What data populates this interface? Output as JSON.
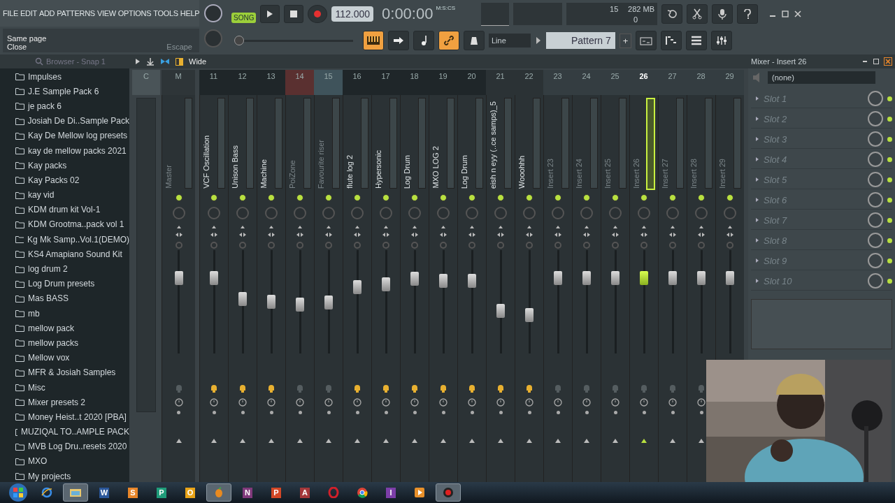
{
  "menu": [
    "FILE",
    "EDIT",
    "ADD",
    "PATTERNS",
    "VIEW",
    "OPTIONS",
    "TOOLS",
    "HELP"
  ],
  "hint": {
    "title": "Same page",
    "action": "Close",
    "shortcut": "Escape"
  },
  "transport": {
    "mode": "SONG",
    "playing": false,
    "recording": true,
    "tempo": "112.000",
    "time": "0:00:00",
    "time_unit": "M:S:CS"
  },
  "performance": {
    "cpu": "15",
    "memory": "282 MB",
    "polyphony": "0"
  },
  "pitch": {
    "level": 0
  },
  "snap": "Line",
  "pattern": "Pattern 7",
  "pattern_add": "+",
  "browser": {
    "title": "Browser - Snap 1",
    "items": [
      "Impulses",
      "J.E Sample Pack 6",
      "je pack 6",
      "Josiah De Di..Sample Pack",
      "Kay De Mellow log presets",
      "kay de mellow packs 2021",
      "Kay packs",
      "Kay Packs 02",
      "kay vid",
      "KDM drum kit Vol-1",
      "KDM Grootma..pack  vol 1",
      "Kg Mk Samp..Vol.1(DEMO)",
      "KS4 Amapiano Sound Kit",
      "log drum 2",
      "Log Drum presets",
      "Mas BASS",
      "mb",
      "mellow pack",
      "mellow packs",
      "Mellow vox",
      "MFR & Josiah Samples",
      "Misc",
      "Mixer presets 2",
      "Money Heist..t 2020 [PBA]",
      "MUZIQAL TO..AMPLE PACK",
      "MVB Log Dru..resets 2020",
      "MXO",
      "My projects"
    ]
  },
  "mixer": {
    "view": "Wide",
    "current_column": "C",
    "tracks": [
      {
        "number": "M",
        "name": "Master",
        "level": 0.73,
        "color": "#2e3538",
        "active": false,
        "selected": false
      },
      {
        "number": "11",
        "name": "VCF Oscillation",
        "level": 0.73,
        "color": "#1f2629",
        "active": true,
        "selected": false
      },
      {
        "number": "12",
        "name": "Unison Bass",
        "level": 0.53,
        "color": "#1f2629",
        "active": true,
        "selected": false
      },
      {
        "number": "13",
        "name": "Machine",
        "level": 0.5,
        "color": "#1f2629",
        "active": true,
        "selected": false
      },
      {
        "number": "14",
        "name": "PoiZone",
        "level": 0.47,
        "color": "#5a3030",
        "active": false,
        "selected": false
      },
      {
        "number": "15",
        "name": "Favourite riser",
        "level": 0.49,
        "color": "#3f535b",
        "active": false,
        "selected": false
      },
      {
        "number": "16",
        "name": "flute log 2",
        "level": 0.64,
        "color": "#1f2629",
        "active": true,
        "selected": false
      },
      {
        "number": "17",
        "name": "Hypersonic",
        "level": 0.67,
        "color": "#1f2629",
        "active": true,
        "selected": false
      },
      {
        "number": "18",
        "name": "Log Drum",
        "level": 0.72,
        "color": "#1f2629",
        "active": true,
        "selected": false
      },
      {
        "number": "19",
        "name": "MXO LOG 2",
        "level": 0.7,
        "color": "#1f2629",
        "active": true,
        "selected": false
      },
      {
        "number": "20",
        "name": "Log Drum",
        "level": 0.7,
        "color": "#1f2629",
        "active": true,
        "selected": false
      },
      {
        "number": "21",
        "name": "eish n eyy (..ce samps)_5",
        "level": 0.41,
        "color": "#2b3235",
        "active": true,
        "selected": false
      },
      {
        "number": "22",
        "name": "Wooohhh",
        "level": 0.37,
        "color": "#2b3235",
        "active": true,
        "selected": false
      },
      {
        "number": "23",
        "name": "Insert 23",
        "level": 0.73,
        "color": "#343d41",
        "active": false,
        "selected": false
      },
      {
        "number": "24",
        "name": "Insert 24",
        "level": 0.73,
        "color": "#343d41",
        "active": false,
        "selected": false
      },
      {
        "number": "25",
        "name": "Insert 25",
        "level": 0.73,
        "color": "#343d41",
        "active": false,
        "selected": false
      },
      {
        "number": "26",
        "name": "Insert 26",
        "level": 0.73,
        "color": "#343d41",
        "active": false,
        "selected": true
      },
      {
        "number": "27",
        "name": "Insert 27",
        "level": 0.73,
        "color": "#343d41",
        "active": false,
        "selected": false
      },
      {
        "number": "28",
        "name": "Insert 28",
        "level": 0.73,
        "color": "#343d41",
        "active": false,
        "selected": false
      },
      {
        "number": "29",
        "name": "Insert 29",
        "level": 0.73,
        "color": "#343d41",
        "active": false,
        "selected": false
      }
    ]
  },
  "insert_panel": {
    "title": "Mixer - Insert 26",
    "preset": "(none)",
    "slots": [
      "Slot 1",
      "Slot 2",
      "Slot 3",
      "Slot 4",
      "Slot 5",
      "Slot 6",
      "Slot 7",
      "Slot 8",
      "Slot 9",
      "Slot 10"
    ]
  },
  "taskbar": [
    {
      "kind": "browser",
      "selected": false
    },
    {
      "kind": "folder",
      "selected": true
    },
    {
      "kind": "letter",
      "label": "W",
      "color": "#2b579a",
      "selected": false
    },
    {
      "kind": "letter",
      "label": "S",
      "color": "#e8862a",
      "selected": false
    },
    {
      "kind": "letter",
      "label": "P",
      "color": "#1f9c7a",
      "selected": false
    },
    {
      "kind": "letter",
      "label": "O",
      "color": "#e8a317",
      "selected": false
    },
    {
      "kind": "fl",
      "selected": true
    },
    {
      "kind": "letter",
      "label": "N",
      "color": "#80397b",
      "selected": false
    },
    {
      "kind": "letter",
      "label": "P",
      "color": "#d24726",
      "selected": false
    },
    {
      "kind": "letter",
      "label": "A",
      "color": "#a4373a",
      "selected": false
    },
    {
      "kind": "opera",
      "selected": false
    },
    {
      "kind": "chrome",
      "selected": false
    },
    {
      "kind": "letter",
      "label": "I",
      "color": "#7c3ea8",
      "selected": false
    },
    {
      "kind": "player",
      "selected": false
    },
    {
      "kind": "record",
      "selected": true
    }
  ]
}
